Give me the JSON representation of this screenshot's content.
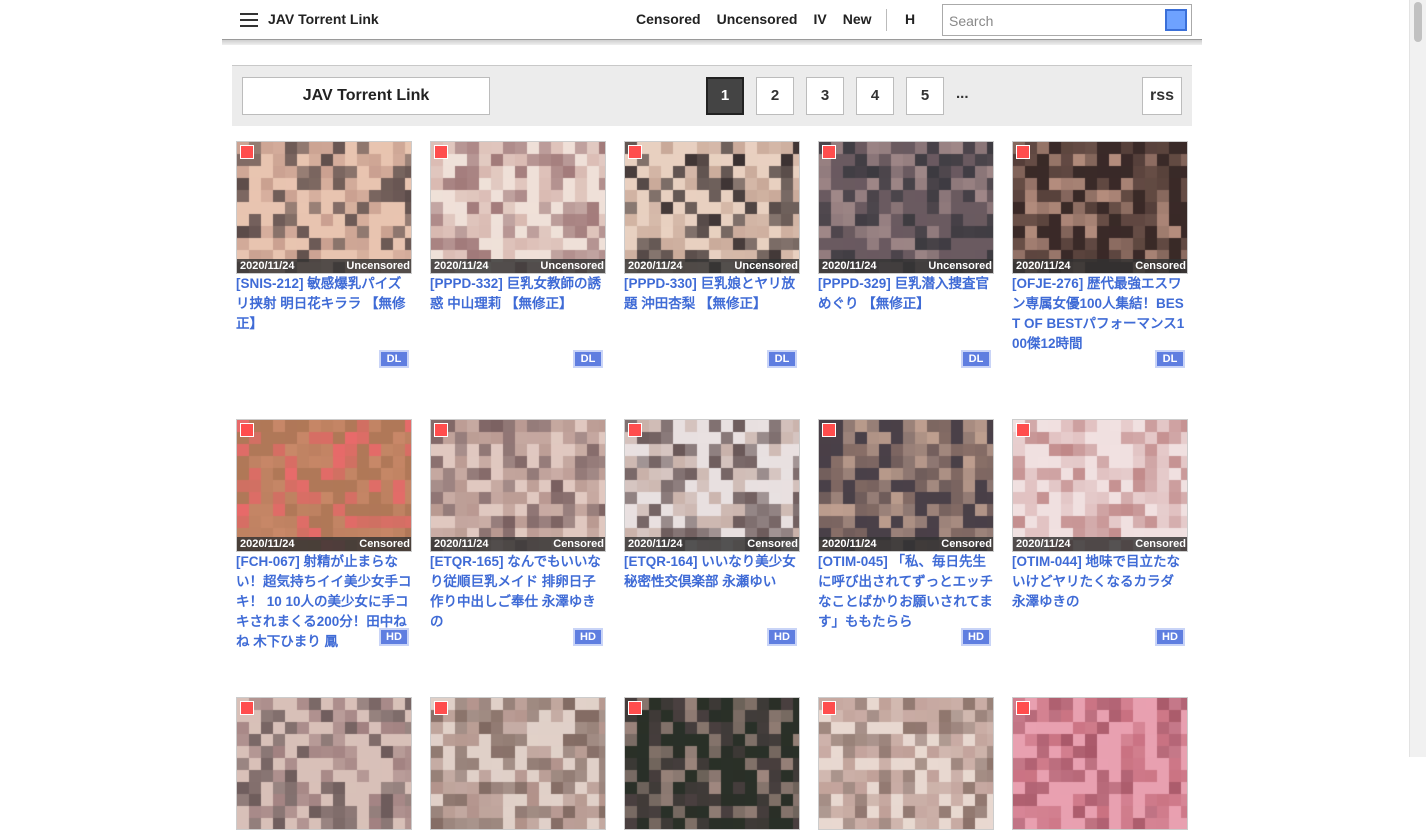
{
  "nav": {
    "title": "JAV Torrent Link",
    "links": [
      "Censored",
      "Uncensored",
      "IV",
      "New"
    ],
    "h_label": "H",
    "search_placeholder": "Search"
  },
  "header": {
    "site_label": "JAV Torrent Link",
    "pages": [
      "1",
      "2",
      "3",
      "4",
      "5"
    ],
    "active_page": "1",
    "ellipsis": "...",
    "rss_label": "rss"
  },
  "colors": {
    "link": "#3f6bd6",
    "badge": "#5f7ee0",
    "check": "#ff4d4d"
  },
  "cards": [
    {
      "date": "2020/11/24",
      "category": "Uncensored",
      "title": "[SNIS-212] 敏感爆乳パイズリ挟射 明日花キララ 【無修正】",
      "badge": "DL",
      "palette": [
        "#c9a090",
        "#5a4a48",
        "#e8c4b0"
      ]
    },
    {
      "date": "2020/11/24",
      "category": "Uncensored",
      "title": "[PPPD-332] 巨乳女教師の誘惑 中山理莉 【無修正】",
      "badge": "DL",
      "palette": [
        "#d8b8b0",
        "#a07878",
        "#efe0d8"
      ]
    },
    {
      "date": "2020/11/24",
      "category": "Uncensored",
      "title": "[PPPD-330] 巨乳娘とヤリ放題 沖田杏梨 【無修正】",
      "badge": "DL",
      "palette": [
        "#3a3030",
        "#c8a898",
        "#e8d0c0"
      ]
    },
    {
      "date": "2020/11/24",
      "category": "Uncensored",
      "title": "[PPPD-329] 巨乳潜入捜査官 めぐり 【無修正】",
      "badge": "DL",
      "palette": [
        "#3c3a40",
        "#a08888",
        "#6a5a60"
      ]
    },
    {
      "date": "2020/11/24",
      "category": "Censored",
      "title": "[OFJE-276] 歴代最強エスワン専属女優100人集結！BEST OF BESTパフォーマンス100傑12時間",
      "badge": "DL",
      "palette": [
        "#6a5048",
        "#b89080",
        "#3a2a28"
      ]
    },
    {
      "date": "2020/11/24",
      "category": "Censored",
      "title": "[FCH-067] 射精が止まらない！超気持ちイイ美少女手コキ！ 10 10人の美少女に手コキされまくる200分！田中ねね 木下ひまり 鳳",
      "badge": "HD",
      "palette": [
        "#c88868",
        "#e86a6a",
        "#b07858"
      ]
    },
    {
      "date": "2020/11/24",
      "category": "Censored",
      "title": "[ETQR-165] なんでもいいなり従順巨乳メイド 排卵日子作り中出しご奉仕 永澤ゆきの",
      "badge": "HD",
      "palette": [
        "#b89890",
        "#7a6060",
        "#e0c8c0"
      ]
    },
    {
      "date": "2020/11/24",
      "category": "Censored",
      "title": "[ETQR-164] いいなり美少女秘密性交倶楽部 永瀬ゆい",
      "badge": "HD",
      "palette": [
        "#c8b0a8",
        "#6a5858",
        "#e8e0e0"
      ]
    },
    {
      "date": "2020/11/24",
      "category": "Censored",
      "title": "[OTIM-045] 「私、毎日先生に呼び出されてずっとエッチなことばかりお願いされてます」ももたらら",
      "badge": "HD",
      "palette": [
        "#8a7068",
        "#c0a090",
        "#4a4048"
      ]
    },
    {
      "date": "2020/11/24",
      "category": "Censored",
      "title": "[OTIM-044] 地味で目立たないけどヤリたくなるカラダ 永澤ゆきの",
      "badge": "HD",
      "palette": [
        "#e0c0c0",
        "#c08888",
        "#f0e0e0"
      ]
    },
    {
      "date": "",
      "category": "",
      "title": "",
      "badge": "",
      "palette": [
        "#a08080",
        "#6a5858",
        "#d8c0b8"
      ]
    },
    {
      "date": "",
      "category": "",
      "title": "",
      "badge": "",
      "palette": [
        "#b09088",
        "#806860",
        "#e0d0c8"
      ]
    },
    {
      "date": "",
      "category": "",
      "title": "",
      "badge": "",
      "palette": [
        "#4a4040",
        "#a08880",
        "#2a3028"
      ]
    },
    {
      "date": "",
      "category": "",
      "title": "",
      "badge": "",
      "palette": [
        "#c0a098",
        "#8a7068",
        "#e8d8d0"
      ]
    },
    {
      "date": "",
      "category": "",
      "title": "",
      "badge": "",
      "palette": [
        "#c87080",
        "#a85868",
        "#e8a0b0"
      ]
    }
  ]
}
